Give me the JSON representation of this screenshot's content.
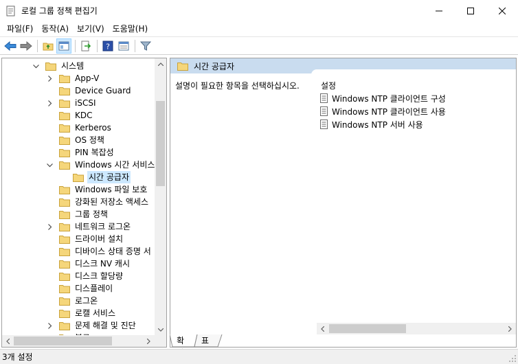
{
  "window": {
    "title": "로컬 그룹 정책 편집기",
    "controls": [
      "minimize-icon",
      "maximize-icon",
      "close-icon"
    ]
  },
  "menu": {
    "items": [
      {
        "label": "파일(F)"
      },
      {
        "label": "동작(A)"
      },
      {
        "label": "보기(V)"
      },
      {
        "label": "도움말(H)"
      }
    ]
  },
  "toolbar": {
    "icons": [
      "back-icon",
      "forward-icon",
      "up-folder-icon",
      "show-hide-tree-icon",
      "export-list-icon",
      "help-icon",
      "properties-pane-icon",
      "filter-icon"
    ]
  },
  "tree": {
    "items": [
      {
        "label": "시스템",
        "expander": "expanded",
        "indent": 0
      },
      {
        "label": "App-V",
        "expander": "collapsed",
        "indent": 1
      },
      {
        "label": "Device Guard",
        "expander": "none",
        "indent": 1
      },
      {
        "label": "iSCSI",
        "expander": "collapsed",
        "indent": 1
      },
      {
        "label": "KDC",
        "expander": "none",
        "indent": 1
      },
      {
        "label": "Kerberos",
        "expander": "none",
        "indent": 1
      },
      {
        "label": "OS 정책",
        "expander": "none",
        "indent": 1
      },
      {
        "label": "PIN 복잡성",
        "expander": "none",
        "indent": 1
      },
      {
        "label": "Windows 시간 서비스",
        "expander": "expanded",
        "indent": 1
      },
      {
        "label": "시간 공급자",
        "expander": "none",
        "indent": 2,
        "selected": true
      },
      {
        "label": "Windows 파일 보호",
        "expander": "none",
        "indent": 1
      },
      {
        "label": "강화된 저장소 액세스",
        "expander": "none",
        "indent": 1
      },
      {
        "label": "그룹 정책",
        "expander": "none",
        "indent": 1
      },
      {
        "label": "네트워크 로그온",
        "expander": "collapsed",
        "indent": 1
      },
      {
        "label": "드라이버 설치",
        "expander": "none",
        "indent": 1
      },
      {
        "label": "디바이스 상태 증명 서",
        "expander": "none",
        "indent": 1
      },
      {
        "label": "디스크 NV 캐시",
        "expander": "none",
        "indent": 1
      },
      {
        "label": "디스크 할당량",
        "expander": "none",
        "indent": 1
      },
      {
        "label": "디스플레이",
        "expander": "none",
        "indent": 1
      },
      {
        "label": "로그온",
        "expander": "none",
        "indent": 1
      },
      {
        "label": "로캘 서비스",
        "expander": "none",
        "indent": 1
      },
      {
        "label": "문제 해결 및 진단",
        "expander": "collapsed",
        "indent": 1
      },
      {
        "label": "복구",
        "expander": "none",
        "indent": 1
      }
    ]
  },
  "details": {
    "header_title": "시간 공급자",
    "description": "설명이 필요한 항목을 선택하십시오.",
    "column_header": "설정",
    "items": [
      {
        "label": "Windows NTP 클라이언트 구성"
      },
      {
        "label": "Windows NTP 클라이언트 사용"
      },
      {
        "label": "Windows NTP 서버 사용"
      }
    ]
  },
  "tabs": [
    {
      "label": "확장",
      "active": true
    },
    {
      "label": "표준",
      "active": false
    }
  ],
  "status": {
    "text": "3개 설정"
  },
  "colors": {
    "selection": "#cce8ff",
    "header_band": "#c9dcef",
    "folder": "#f5d67b",
    "status_bar": "#f0f0f0"
  }
}
